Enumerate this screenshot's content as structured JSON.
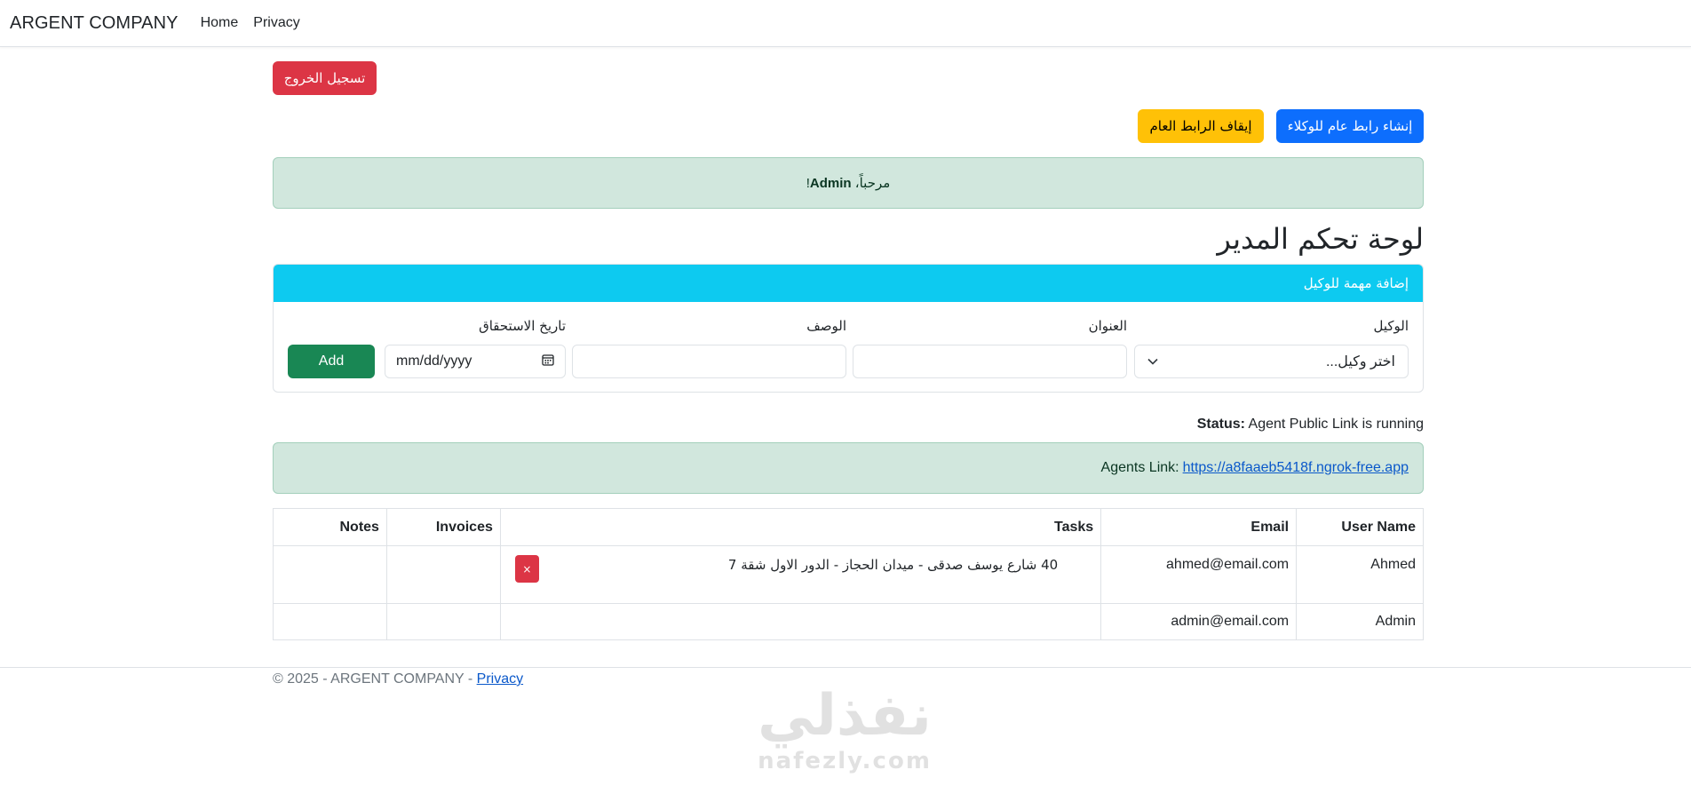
{
  "navbar": {
    "brand": "ARGENT COMPANY",
    "links": [
      "Home",
      "Privacy"
    ]
  },
  "buttons": {
    "logout": "تسجيل الخروج",
    "create_public_link": "إنشاء رابط عام للوكلاء",
    "stop_public_link": "إيقاف الرابط العام"
  },
  "welcome": {
    "prefix": "مرحباً،",
    "name": "Admin",
    "suffix": "!"
  },
  "page_title": "لوحة تحكم المدير",
  "task_form": {
    "header": "إضافة مهمة للوكيل",
    "labels": {
      "agent": "الوكيل",
      "title": "العنوان",
      "description": "الوصف",
      "due_date": "تاريخ الاستحقاق"
    },
    "agent_select": "اختر وكيل...",
    "date_placeholder": "mm/dd/yyyy",
    "add_button": "Add"
  },
  "status": {
    "label": "Status:",
    "text": "Agent Public Link is running"
  },
  "agents_link": {
    "label": "Agents Link:",
    "url": "https://a8faaeb5418f.ngrok-free.app"
  },
  "table": {
    "headers": [
      "User Name",
      "Email",
      "Tasks",
      "Invoices",
      "Notes"
    ],
    "rows": [
      {
        "user": "Ahmed",
        "email": "ahmed@email.com",
        "task": "40 شارع يوسف صدقى - ميدان الحجاز - الدور الاول شقة 7",
        "delete": "×"
      },
      {
        "user": "Admin",
        "email": "admin@email.com",
        "task": ""
      }
    ]
  },
  "footer": {
    "text": "© 2025 - ARGENT COMPANY - ",
    "link": "Privacy"
  },
  "watermark": {
    "arabic": "نفذلي",
    "latin": "nafezly.com"
  },
  "colors": {
    "danger": "#dc3545",
    "primary": "#0d6efd",
    "warning": "#ffc107",
    "info": "#0dcaf0",
    "success": "#198754",
    "alert_success_bg": "#d1e7dd"
  }
}
